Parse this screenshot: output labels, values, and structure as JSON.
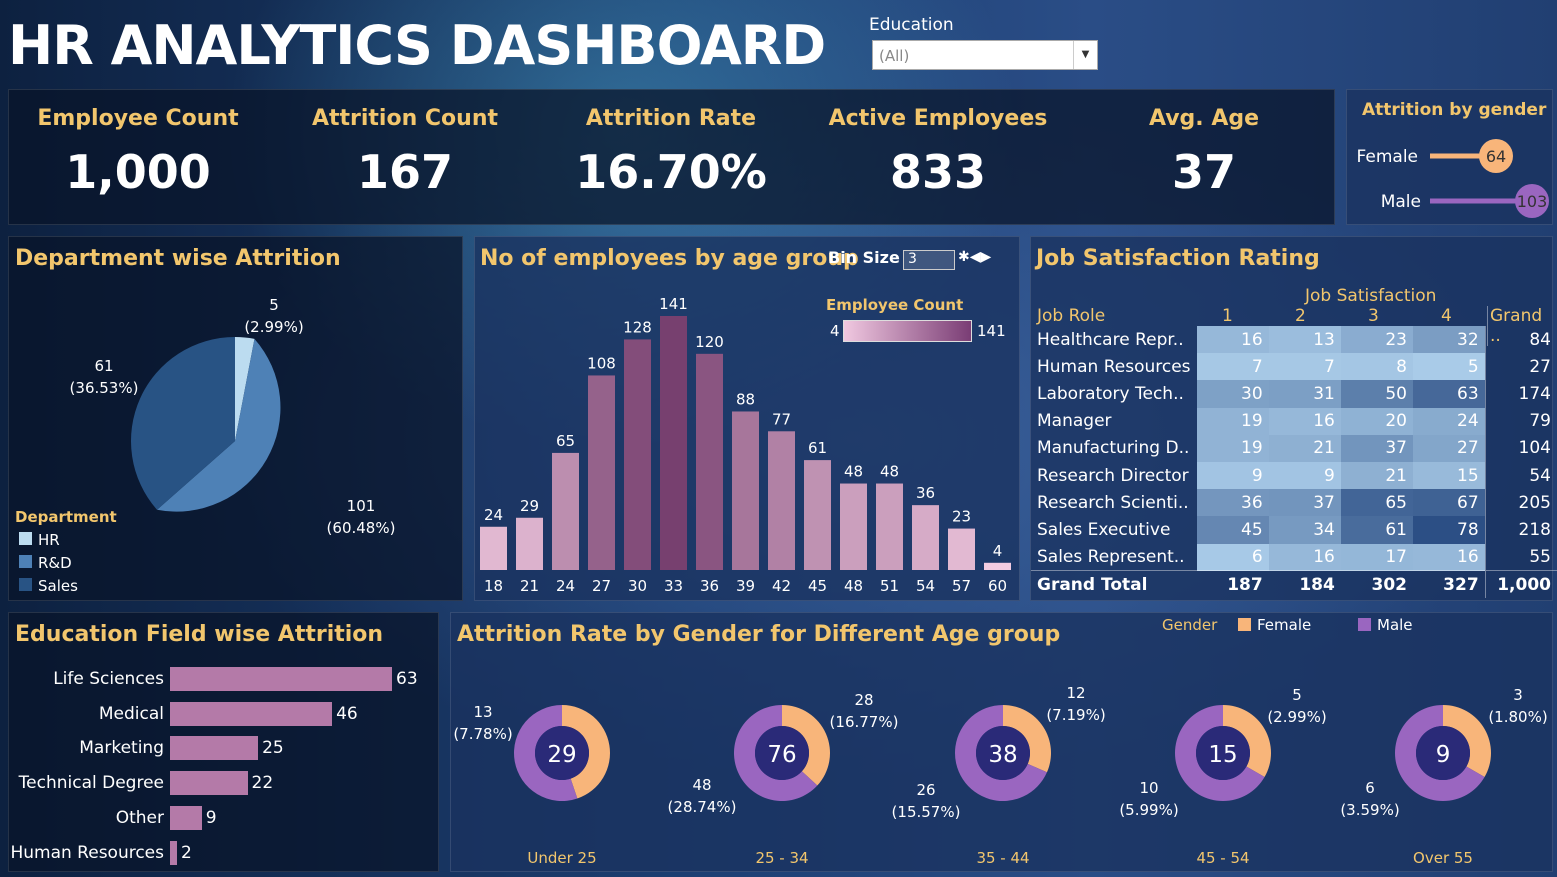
{
  "header": {
    "title": "HR ANALYTICS DASHBOARD",
    "filter_label": "Education",
    "filter_value": "(All)"
  },
  "kpis": [
    {
      "label": "Employee Count",
      "value": "1,000"
    },
    {
      "label": "Attrition Count",
      "value": "167"
    },
    {
      "label": "Attrition Rate",
      "value": "16.70%"
    },
    {
      "label": "Active Employees",
      "value": "833"
    },
    {
      "label": "Avg. Age",
      "value": "37"
    }
  ],
  "gender_attrition": {
    "title": "Attrition by gender",
    "items": [
      {
        "label": "Female",
        "value": 64,
        "color": "#f8b57a"
      },
      {
        "label": "Male",
        "value": 103,
        "color": "#9a66c0"
      }
    ]
  },
  "department": {
    "title": "Department wise Attrition",
    "legend_title": "Department",
    "slices": [
      {
        "label": "HR",
        "value": 5,
        "pct": "(2.99%)",
        "color": "#bcdcf0"
      },
      {
        "label": "R&D",
        "value": 101,
        "pct": "(60.48%)",
        "color": "#4e81b6"
      },
      {
        "label": "Sales",
        "value": 61,
        "pct": "(36.53%)",
        "color": "#285384"
      }
    ]
  },
  "age_group": {
    "title": "No of employees by age group",
    "bin_label": "Bin Size",
    "bin_value": "3",
    "legend_title": "Employee Count",
    "legend_min": "4",
    "legend_max": "141"
  },
  "job_satisfaction": {
    "title": "Job Satisfaction Rating",
    "col_header": "Job Satisfaction",
    "row_header": "Job Role",
    "columns": [
      "1",
      "2",
      "3",
      "4",
      "Grand .."
    ],
    "rows": [
      {
        "role": "Healthcare Repr..",
        "values": [
          16,
          13,
          23,
          32
        ],
        "total": "84"
      },
      {
        "role": "Human Resources",
        "values": [
          7,
          7,
          8,
          5
        ],
        "total": "27"
      },
      {
        "role": "Laboratory Tech..",
        "values": [
          30,
          31,
          50,
          63
        ],
        "total": "174"
      },
      {
        "role": "Manager",
        "values": [
          19,
          16,
          20,
          24
        ],
        "total": "79"
      },
      {
        "role": "Manufacturing D..",
        "values": [
          19,
          21,
          37,
          27
        ],
        "total": "104"
      },
      {
        "role": "Research Director",
        "values": [
          9,
          9,
          21,
          15
        ],
        "total": "54"
      },
      {
        "role": "Research Scienti..",
        "values": [
          36,
          37,
          65,
          67
        ],
        "total": "205"
      },
      {
        "role": "Sales Executive",
        "values": [
          45,
          34,
          61,
          78
        ],
        "total": "218"
      },
      {
        "role": "Sales Represent..",
        "values": [
          6,
          16,
          17,
          16
        ],
        "total": "55"
      }
    ],
    "grand_total": {
      "label": "Grand Total",
      "values": [
        "187",
        "184",
        "302",
        "327"
      ],
      "total": "1,000"
    }
  },
  "education": {
    "title": "Education Field wise Attrition",
    "items": [
      {
        "label": "Life Sciences",
        "value": 63
      },
      {
        "label": "Medical",
        "value": 46
      },
      {
        "label": "Marketing",
        "value": 25
      },
      {
        "label": "Technical Degree",
        "value": 22
      },
      {
        "label": "Other",
        "value": 9
      },
      {
        "label": "Human Resources",
        "value": 2
      }
    ]
  },
  "gender_age": {
    "title": "Attrition Rate by Gender for Different Age group",
    "legend_title": "Gender",
    "legend": [
      {
        "label": "Female",
        "color": "#f8b57a"
      },
      {
        "label": "Male",
        "color": "#9a66c0"
      }
    ],
    "groups": [
      {
        "label": "Under 25",
        "total": "29",
        "female": 13,
        "female_pct": "(7.78%)",
        "male": 16,
        "male_pct": ""
      },
      {
        "label": "25 - 34",
        "total": "76",
        "female": 28,
        "female_pct": "(16.77%)",
        "male": 48,
        "male_pct": "(28.74%)"
      },
      {
        "label": "35 - 44",
        "total": "38",
        "female": 12,
        "female_pct": "(7.19%)",
        "male": 26,
        "male_pct": "(15.57%)"
      },
      {
        "label": "45 - 54",
        "total": "15",
        "female": 5,
        "female_pct": "(2.99%)",
        "male": 10,
        "male_pct": "(5.99%)"
      },
      {
        "label": "Over 55",
        "total": "9",
        "female": 3,
        "female_pct": "(1.80%)",
        "male": 6,
        "male_pct": "(3.59%)"
      }
    ]
  },
  "chart_data": [
    {
      "type": "bar",
      "title": "No of employees by age group",
      "categories": [
        "18",
        "21",
        "24",
        "27",
        "30",
        "33",
        "36",
        "39",
        "42",
        "45",
        "48",
        "51",
        "54",
        "57",
        "60"
      ],
      "values": [
        24,
        29,
        65,
        108,
        128,
        141,
        120,
        88,
        77,
        61,
        48,
        48,
        36,
        23,
        4
      ],
      "ylim": [
        0,
        141
      ]
    },
    {
      "type": "pie",
      "title": "Department wise Attrition",
      "categories": [
        "HR",
        "R&D",
        "Sales"
      ],
      "values": [
        5,
        101,
        61
      ]
    },
    {
      "type": "bar",
      "title": "Education Field wise Attrition",
      "categories": [
        "Life Sciences",
        "Medical",
        "Marketing",
        "Technical Degree",
        "Other",
        "Human Resources"
      ],
      "values": [
        63,
        46,
        25,
        22,
        9,
        2
      ]
    }
  ]
}
